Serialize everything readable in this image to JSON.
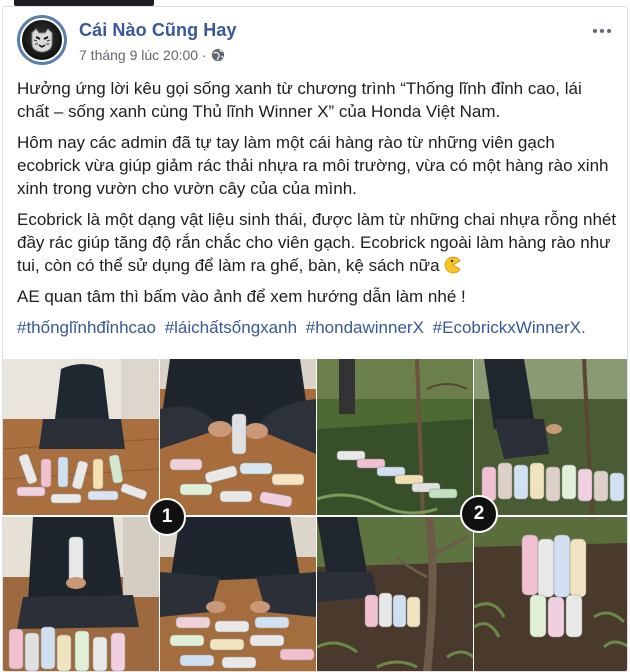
{
  "post": {
    "page_name": "Cái Nào Cũng Hay",
    "timestamp": "7 tháng 9 lúc 20:00 ·",
    "paragraphs": [
      "Hưởng ứng lời kêu gọi sống xanh từ chương trình “Thống lĩnh đỉnh cao, lái chất – sống xanh cùng Thủ lĩnh Winner X” của Honda Việt Nam.",
      "Hôm nay các admin đã tự tay làm một cái hàng rào từ những viên gạch ecobrick vừa giúp giảm rác thải nhựa ra môi trường, vừa có một hàng rào xinh xinh trong vườn cho vườn cây của của mình.",
      "Ecobrick là một dạng vật liệu sinh thái, được làm từ những chai nhựa rỗng nhét đầy rác giúp tăng độ rắn chắc cho viên gạch. Ecobrick ngoài làm hàng rào như tui, còn có thể sử dụng để làm ra ghế, bàn, kệ sách nữa",
      "AE quan tâm thì bấm vào ảnh để xem hướng dẫn làm nhé !"
    ],
    "hashtags": [
      "#thốnglĩnhđỉnhcao",
      "#láichấtsốngxanh",
      "#hondawinnerX",
      "#EcobrickxWinnerX."
    ],
    "icons": {
      "avatar": "tiger-logo-icon",
      "privacy": "globe-icon",
      "more": "more-options-icon",
      "emoji": "pacman-emoji-icon"
    }
  },
  "photos": {
    "badges": [
      "1",
      "2"
    ]
  },
  "colors": {
    "link": "#385898",
    "meta": "#606770",
    "text": "#1c1e21"
  }
}
